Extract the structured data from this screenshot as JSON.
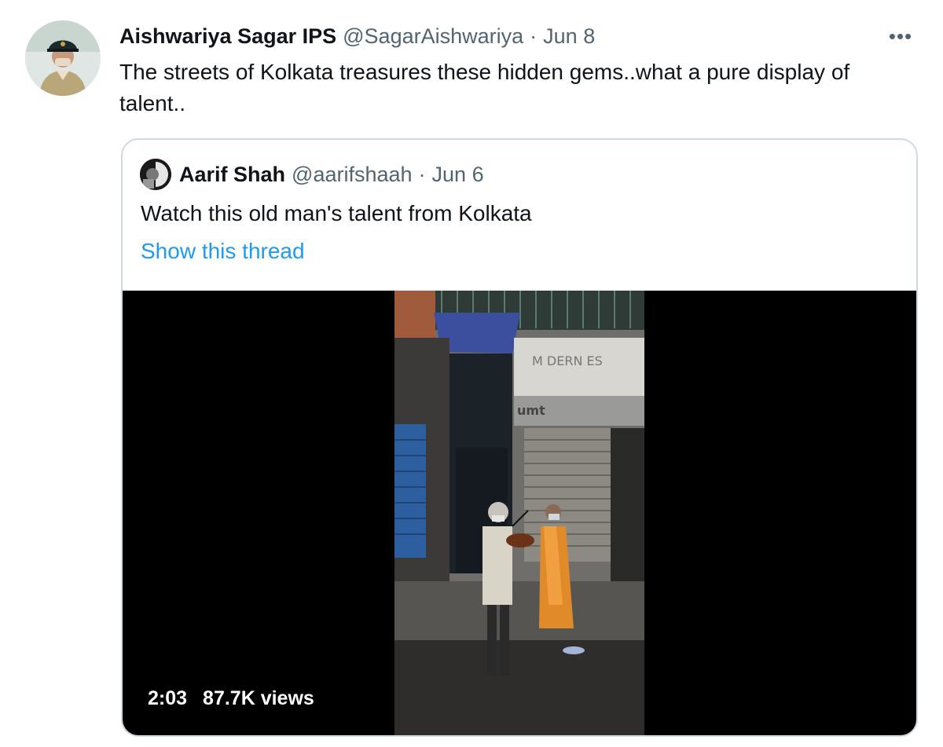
{
  "tweet": {
    "author_name": "Aishwariya Sagar IPS",
    "author_handle": "@SagarAishwariya",
    "separator": "·",
    "date": "Jun 8",
    "more_icon": "•••",
    "text": "The streets of Kolkata treasures these hidden gems..what a pure display of talent.."
  },
  "quoted": {
    "author_name": "Aarif Shah",
    "author_handle": "@aarifshaah",
    "separator": "·",
    "date": "Jun 6",
    "text": "Watch this old man's talent from Kolkata",
    "thread_link": "Show this thread",
    "video": {
      "duration": "2:03",
      "views": "87.7K views"
    }
  },
  "colors": {
    "link": "#1d9bf0",
    "secondary_text": "#536471",
    "border": "#cfd9de"
  }
}
